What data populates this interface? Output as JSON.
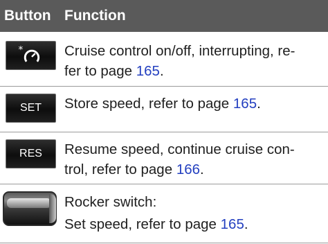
{
  "header": {
    "col1": "Button",
    "col2": "Function"
  },
  "rows": [
    {
      "icon": "cruise-control-toggle-icon",
      "lines": [
        {
          "text": "Cruise control on/off, interrupting, re-"
        },
        {
          "text": "fer to page ",
          "link": "165",
          "tail": "."
        }
      ]
    },
    {
      "icon_label": "SET",
      "lines": [
        {
          "text": "Store speed, refer to page ",
          "link": "165",
          "tail": "."
        }
      ]
    },
    {
      "icon_label": "RES",
      "lines": [
        {
          "text": "Resume speed, continue cruise con-"
        },
        {
          "text": "trol, refer to page ",
          "link": "166",
          "tail": "."
        }
      ]
    },
    {
      "icon": "rocker-switch-icon",
      "lines": [
        {
          "text": "Rocker switch:"
        },
        {
          "text": "Set speed, refer to page ",
          "link": "165",
          "tail": "."
        }
      ]
    }
  ],
  "colors": {
    "header_bg": "#5a5a5a",
    "link": "#2440c0",
    "rule": "#9a9a9a"
  }
}
